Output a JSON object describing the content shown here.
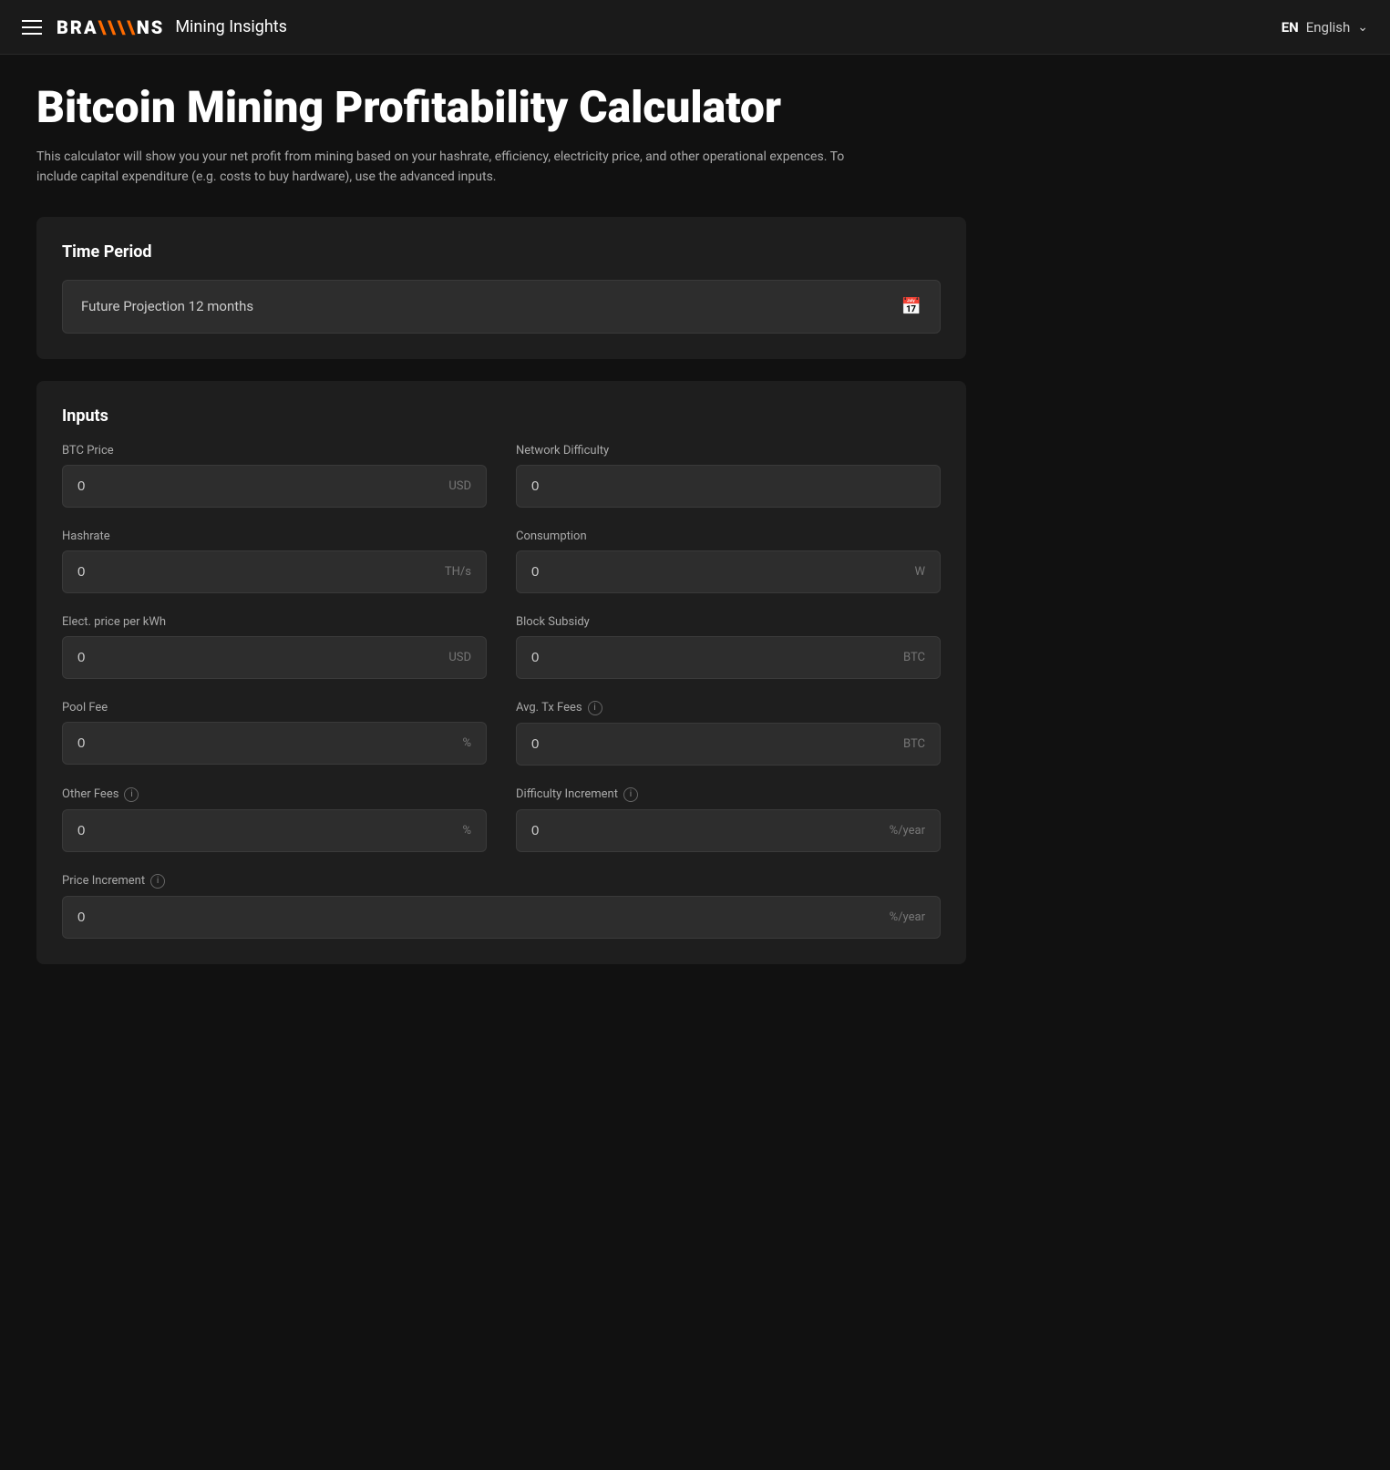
{
  "header": {
    "menu_icon": "hamburger",
    "logo_brand": "BRA\\\\NS",
    "logo_subtitle": "Mining Insights",
    "lang_code": "EN",
    "lang_label": "English",
    "lang_dropdown_icon": "chevron-down"
  },
  "page": {
    "title": "Bitcoin Mining Profitability Calculator",
    "description": "This calculator will show you your net profit from mining based on your hashrate, efficiency, electricity price, and other operational expences. To include capital expenditure (e.g. costs to buy hardware), use the advanced inputs."
  },
  "time_period": {
    "section_title": "Time Period",
    "selected_value": "Future Projection 12 months",
    "calendar_icon": "calendar"
  },
  "inputs": {
    "section_title": "Inputs",
    "fields": [
      {
        "id": "btc-price",
        "label": "BTC Price",
        "value": "0",
        "unit": "USD",
        "has_info": false,
        "col": "left"
      },
      {
        "id": "network-difficulty",
        "label": "Network Difficulty",
        "value": "0",
        "unit": "",
        "has_info": false,
        "col": "right"
      },
      {
        "id": "hashrate",
        "label": "Hashrate",
        "value": "0",
        "unit": "TH/s",
        "has_info": false,
        "col": "left"
      },
      {
        "id": "consumption",
        "label": "Consumption",
        "value": "0",
        "unit": "W",
        "has_info": false,
        "col": "right"
      },
      {
        "id": "elect-price",
        "label": "Elect. price per kWh",
        "value": "0",
        "unit": "USD",
        "has_info": false,
        "col": "left"
      },
      {
        "id": "block-subsidy",
        "label": "Block Subsidy",
        "value": "0",
        "unit": "BTC",
        "has_info": false,
        "col": "right"
      },
      {
        "id": "pool-fee",
        "label": "Pool Fee",
        "value": "0",
        "unit": "%",
        "has_info": false,
        "col": "left"
      },
      {
        "id": "avg-tx-fees",
        "label": "Avg. Tx Fees",
        "value": "0",
        "unit": "BTC",
        "has_info": true,
        "col": "right"
      },
      {
        "id": "other-fees",
        "label": "Other Fees",
        "value": "0",
        "unit": "%",
        "has_info": true,
        "col": "left"
      },
      {
        "id": "difficulty-increment",
        "label": "Difficulty Increment",
        "value": "0",
        "unit": "%/year",
        "has_info": true,
        "col": "right"
      },
      {
        "id": "price-increment",
        "label": "Price Increment",
        "value": "0",
        "unit": "%/year",
        "has_info": true,
        "col": "full"
      }
    ]
  }
}
